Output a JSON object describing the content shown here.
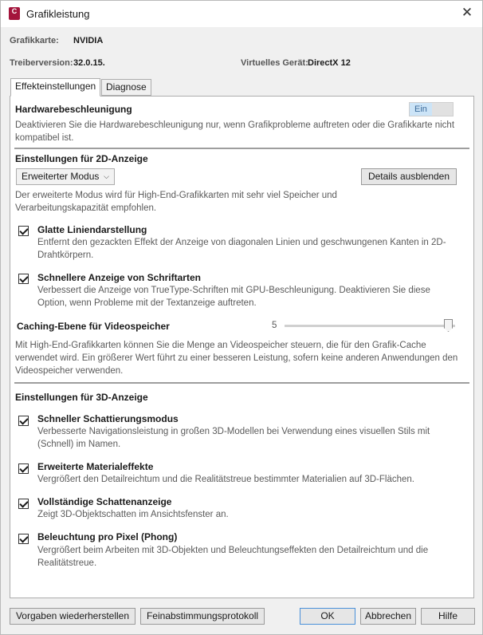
{
  "window": {
    "title": "Grafikleistung",
    "close_glyph": "✕",
    "app_icon_letter": "C"
  },
  "info": {
    "graphics_card_label": "Grafikkarte:",
    "graphics_card_value": "NVIDIA",
    "driver_label": "Treiberversion:",
    "driver_value": "32.0.15.",
    "virtual_device_label": "Virtuelles Gerät:",
    "virtual_device_value": "DirectX 12"
  },
  "tabs": [
    {
      "label": "Effekteinstellungen",
      "active": true
    },
    {
      "label": "Diagnose",
      "active": false
    }
  ],
  "hardware": {
    "title": "Hardwarebeschleunigung",
    "toggle_label": "Ein",
    "toggle_on": true,
    "description": "Deaktivieren Sie die Hardwarebeschleunigung nur, wenn Grafikprobleme auftreten oder die Grafikkarte nicht kompatibel ist."
  },
  "display2d": {
    "title": "Einstellungen für 2D-Anzeige",
    "mode_value": "Erweiterter Modus",
    "details_button": "Details ausblenden",
    "description": "Der erweiterte Modus wird für High-End-Grafikkarten mit sehr viel Speicher und Verarbeitungskapazität empfohlen.",
    "options": [
      {
        "title": "Glatte Liniendarstellung",
        "checked": true,
        "description": "Entfernt den gezackten Effekt der Anzeige von diagonalen Linien und geschwungenen Kanten in 2D-Drahtkörpern."
      },
      {
        "title": "Schnellere Anzeige von Schriftarten",
        "checked": true,
        "description": "Verbessert die Anzeige von TrueType-Schriften mit GPU-Beschleunigung. Deaktivieren Sie diese Option, wenn Probleme mit der Textanzeige auftreten."
      }
    ],
    "cache_title": "Caching-Ebene für Videospeicher",
    "cache_value": "5",
    "cache_level_fraction": 1.0,
    "cache_description": "Mit High-End-Grafikkarten können Sie die Menge an Videospeicher steuern, die für den Grafik-Cache verwendet wird. Ein größerer Wert führt zu einer besseren Leistung, sofern keine anderen Anwendungen den Videospeicher verwenden."
  },
  "display3d": {
    "title": "Einstellungen für 3D-Anzeige",
    "options": [
      {
        "title": "Schneller Schattierungsmodus",
        "checked": true,
        "description": "Verbesserte Navigationsleistung in großen 3D-Modellen bei Verwendung eines visuellen Stils mit (Schnell) im Namen."
      },
      {
        "title": "Erweiterte Materialeffekte",
        "checked": true,
        "description": "Vergrößert den Detailreichtum und die Realitätstreue bestimmter Materialien auf 3D-Flächen."
      },
      {
        "title": "Vollständige Schattenanzeige",
        "checked": true,
        "description": "Zeigt 3D-Objektschatten im Ansichtsfenster an."
      },
      {
        "title": "Beleuchtung pro Pixel (Phong)",
        "checked": true,
        "description": "Vergrößert beim Arbeiten mit 3D-Objekten und Beleuchtungseffekten den Detailreichtum und die Realitätstreue."
      }
    ]
  },
  "footer": {
    "restore_defaults": "Vorgaben wiederherstellen",
    "tuning_log": "Feinabstimmungsprotokoll",
    "ok": "OK",
    "cancel": "Abbrechen",
    "help": "Hilfe"
  },
  "colors": {
    "accent": "#4a90d9",
    "toggle_on_bg": "#cce4f7",
    "app_icon": "#a4143c"
  }
}
